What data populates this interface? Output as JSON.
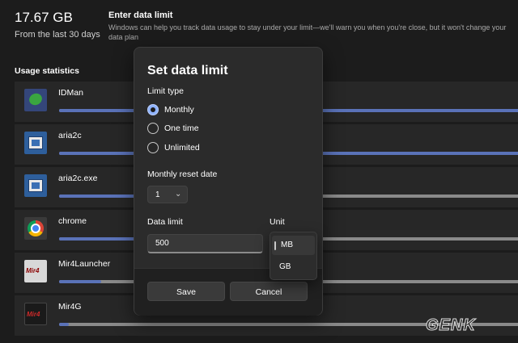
{
  "summary": {
    "total": "17.67 GB",
    "period": "From the last 30 days"
  },
  "limit_info": {
    "title": "Enter data limit",
    "description": "Windows can help you track data usage to stay under your limit—we'll warn you when you're close, but it won't change your data plan"
  },
  "usage": {
    "title": "Usage statistics",
    "apps": [
      {
        "name": "IDMan",
        "icon": "idman-icon",
        "usage_fraction": 1.0
      },
      {
        "name": "aria2c",
        "icon": "aria2c-icon",
        "usage_fraction": 1.0
      },
      {
        "name": "aria2c.exe",
        "icon": "aria2c-icon",
        "usage_fraction": 0.55
      },
      {
        "name": "chrome",
        "icon": "chrome-icon",
        "usage_fraction": 0.2
      },
      {
        "name": "Mir4Launcher",
        "icon": "mir4launcher-icon",
        "usage_fraction": 0.09
      },
      {
        "name": "Mir4G",
        "icon": "mir4g-icon",
        "usage_fraction": 0.02
      }
    ]
  },
  "dialog": {
    "title": "Set data limit",
    "limit_type_label": "Limit type",
    "options": [
      {
        "label": "Monthly",
        "selected": true
      },
      {
        "label": "One time",
        "selected": false
      },
      {
        "label": "Unlimited",
        "selected": false
      }
    ],
    "reset_label": "Monthly reset date",
    "reset_value": "1",
    "data_limit_label": "Data limit",
    "data_limit_value": "500",
    "unit_label": "Unit",
    "unit_options": [
      "MB",
      "GB"
    ],
    "unit_selected": "MB",
    "save_label": "Save",
    "cancel_label": "Cancel"
  },
  "watermark": "GENK",
  "colors": {
    "accent": "#5a72b8",
    "radio_selected": "#8fb3ff",
    "background": "#1c1c1c"
  }
}
